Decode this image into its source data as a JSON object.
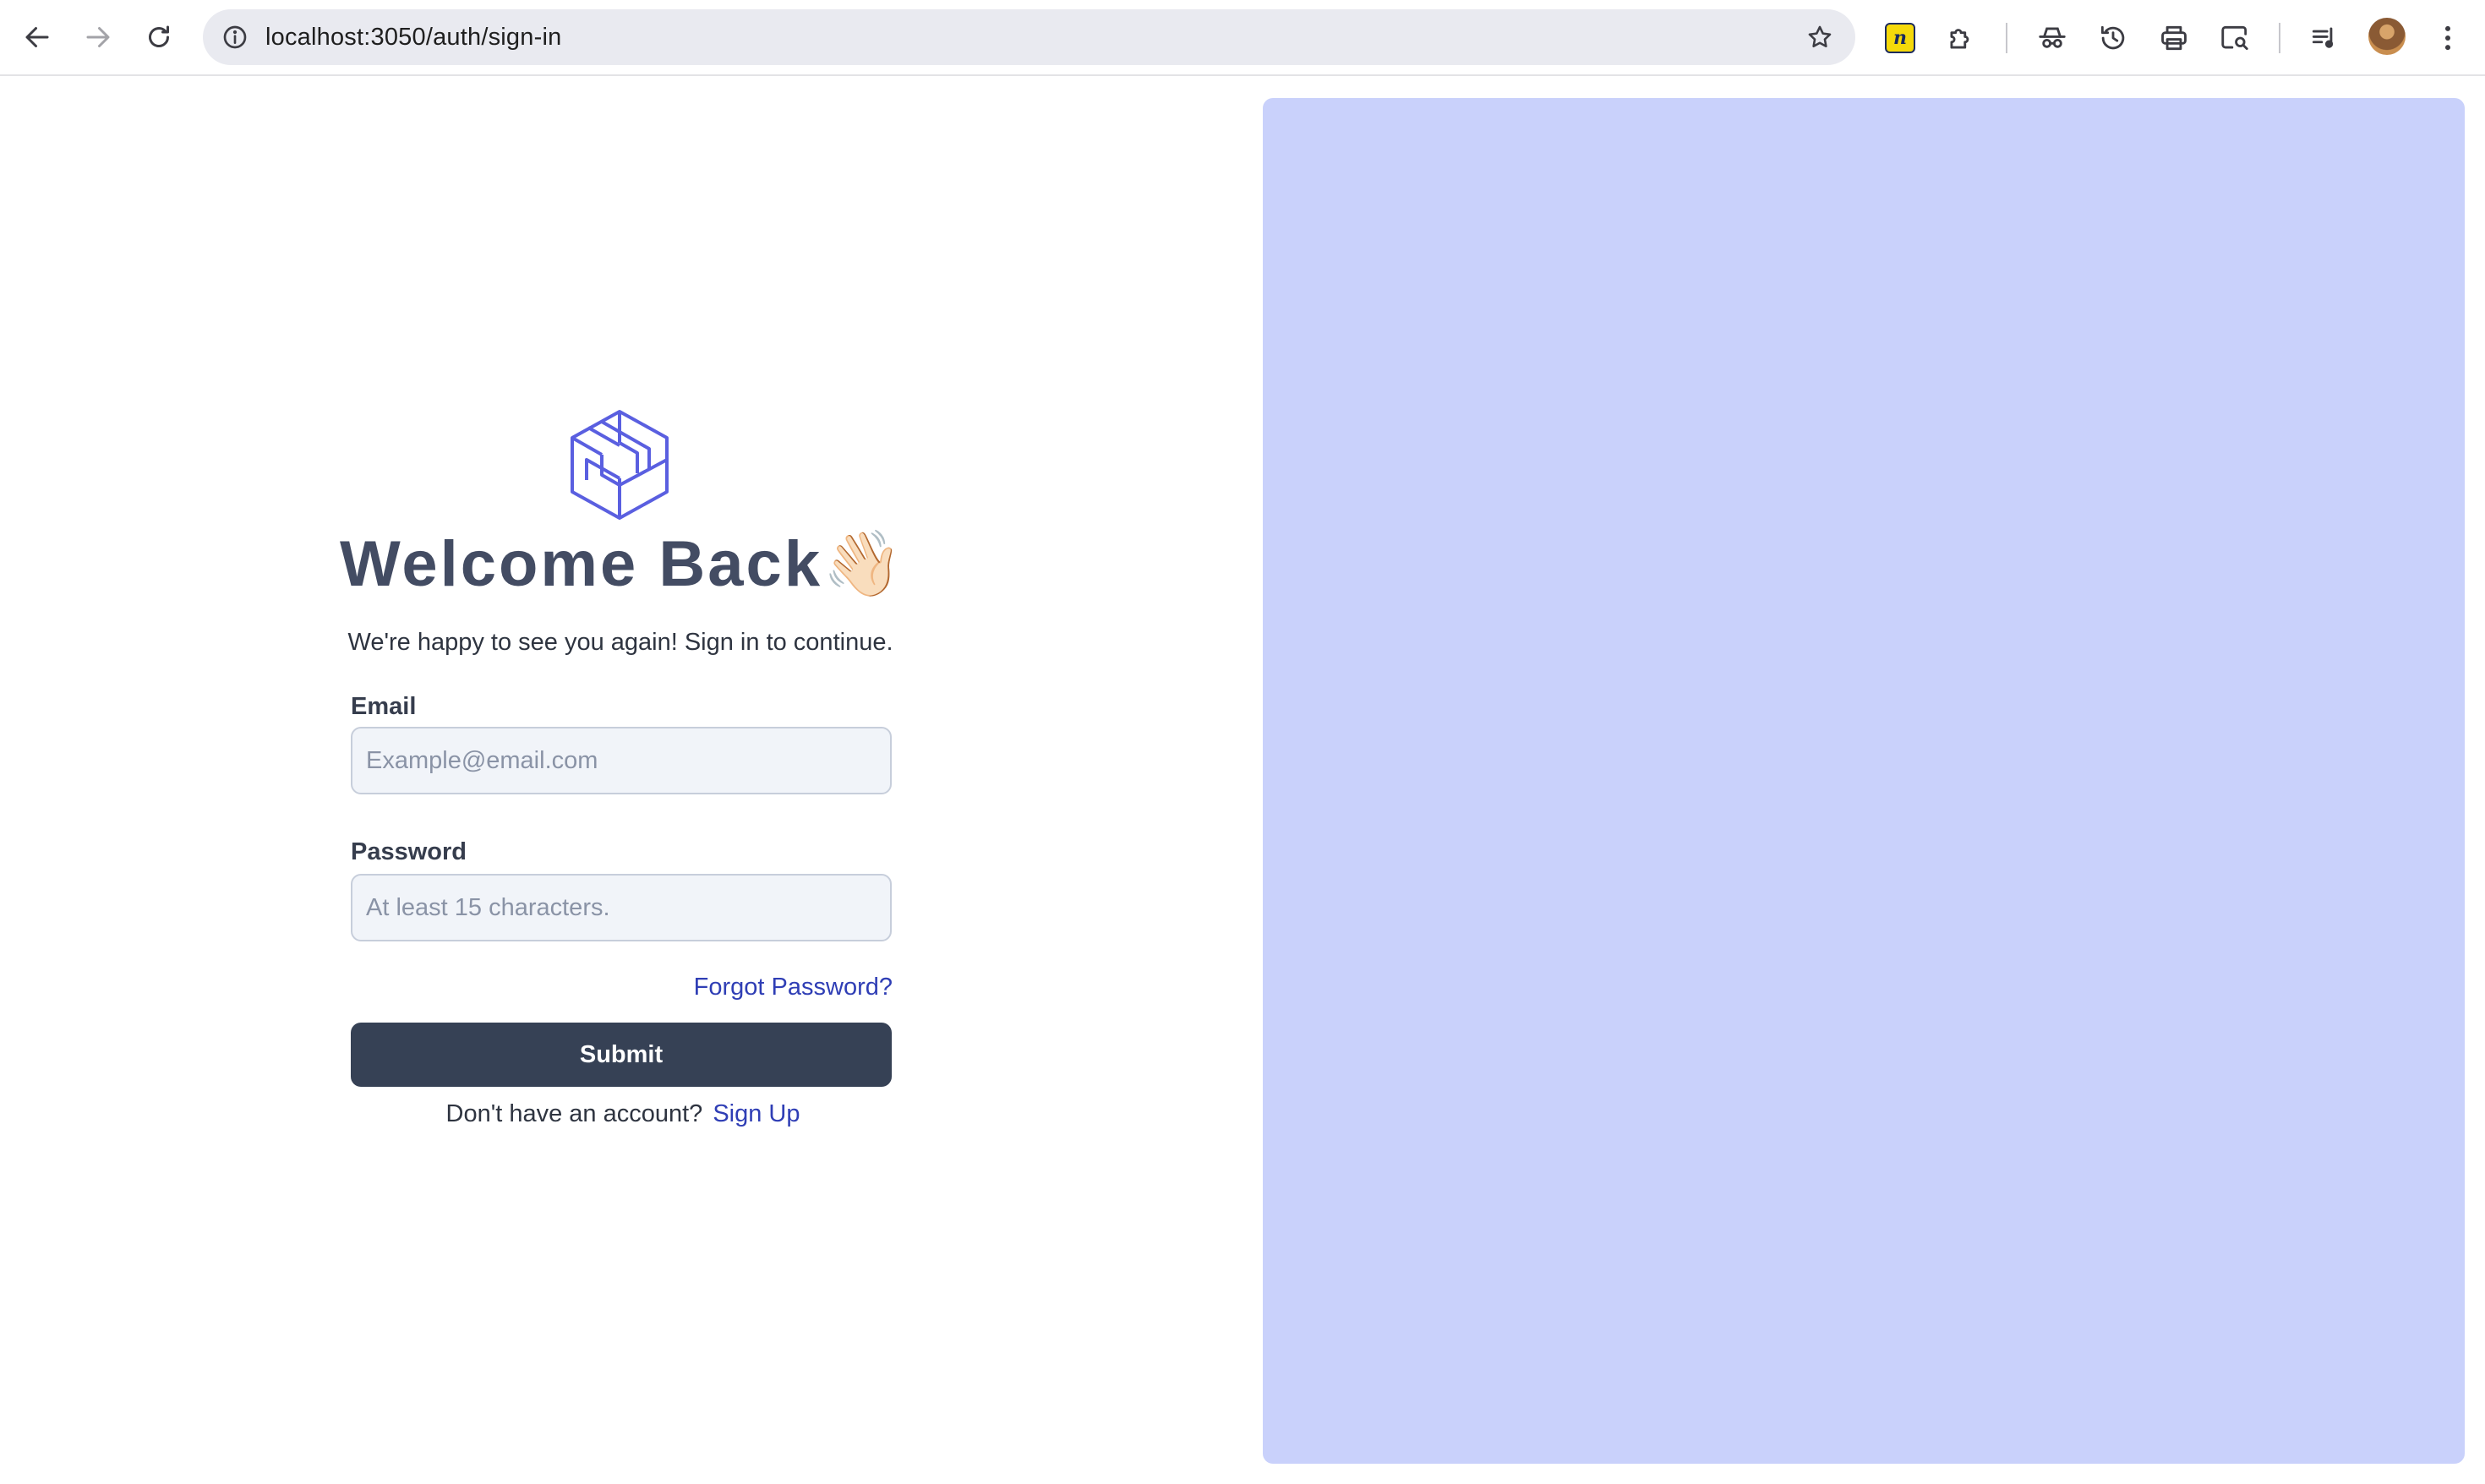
{
  "browser": {
    "url": "localhost:3050/auth/sign-in",
    "extension_badge": "n"
  },
  "signin": {
    "title": "Welcome Back",
    "title_emoji": "👋🏻",
    "subtitle": "We're happy to see you again! Sign in to continue.",
    "email_label": "Email",
    "email_value": "",
    "email_placeholder": "Example@email.com",
    "password_label": "Password",
    "password_value": "",
    "password_placeholder": "At least 15 characters.",
    "forgot_label": "Forgot Password?",
    "submit_label": "Submit",
    "no_account_text": "Don't have an account?",
    "signup_label": "Sign Up"
  },
  "colors": {
    "brand": "#5a5fe0",
    "primary_button": "#364155",
    "link": "#2f3eb5",
    "hero_panel": "#c9d1fb",
    "title": "#434c63"
  },
  "icons": {
    "back": "back-arrow-icon",
    "forward": "forward-arrow-icon",
    "reload": "reload-icon",
    "site_info": "info-icon",
    "bookmark": "star-icon",
    "extensions": "puzzle-icon",
    "incognito": "incognito-icon",
    "history": "history-icon",
    "print": "printer-icon",
    "lens": "lens-search-icon",
    "media": "media-queue-icon",
    "menu": "kebab-menu-icon",
    "logo": "cube-logo-icon"
  }
}
